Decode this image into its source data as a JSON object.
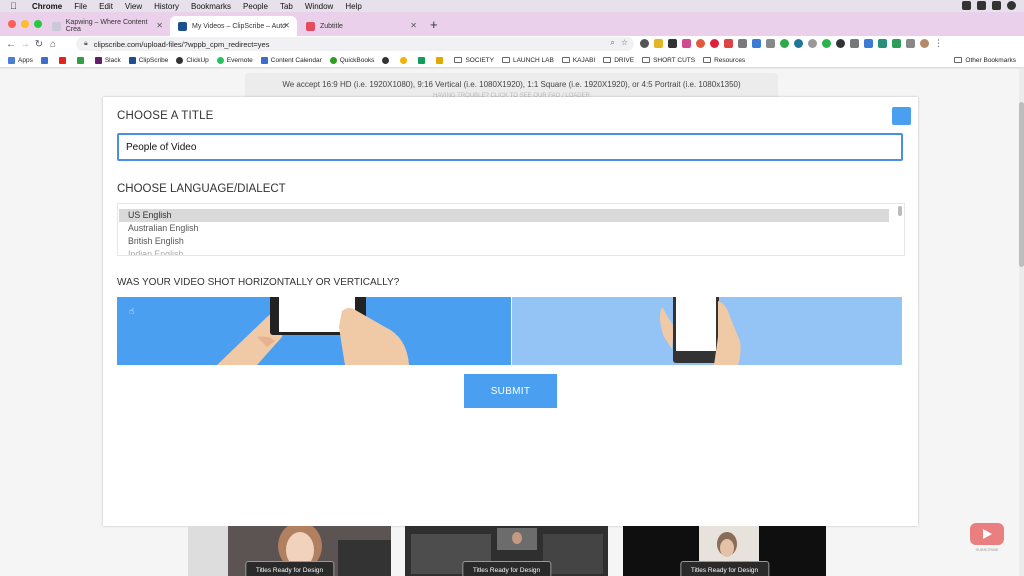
{
  "menubar": {
    "app": "Chrome",
    "items": [
      "File",
      "Edit",
      "View",
      "History",
      "Bookmarks",
      "People",
      "Tab",
      "Window",
      "Help"
    ]
  },
  "tabs": [
    {
      "label": "Kapwing – Where Content Crea",
      "active": false
    },
    {
      "label": "My Videos – ClipScribe – Auto",
      "active": true
    },
    {
      "label": "Zubtitle",
      "active": false
    }
  ],
  "toolbar": {
    "url": "clipscribe.com/upload-files/?wppb_cpm_redirect=yes"
  },
  "bookmarks": {
    "items": [
      "Apps",
      "Slack",
      "ClipScribe",
      "ClickUp",
      "Evernote",
      "Content Calendar",
      "QuickBooks",
      "SOCIETY",
      "LAUNCH LAB",
      "KAJABI",
      "DRIVE",
      "SHORT CUTS",
      "Resources"
    ],
    "other": "Other Bookmarks"
  },
  "page": {
    "info_text": "We accept 16:9 HD (i.e. 1920X1080), 9:16 Vertical (i.e. 1080X1920), 1:1 Square (i.e. 1920X1920), or 4:5 Portrait (i.e. 1080x1350)",
    "info_subtext": "HAVING TROUBLE? CLICK TO SEE OUR FAQ / LOADER",
    "title_heading": "CHOOSE A TITLE",
    "title_value": "People of Video",
    "language_heading": "CHOOSE LANGUAGE/DIALECT",
    "languages": [
      "US English",
      "Australian English",
      "British English",
      "Indian English"
    ],
    "selected_language": "US English",
    "orientation_heading": "WAS YOUR VIDEO SHOT HORIZONTALLY OR VERTICALLY?",
    "submit_label": "SUBMIT",
    "video_cards": [
      {
        "label": "Titles Ready for Design"
      },
      {
        "label": "Titles Ready for Design"
      },
      {
        "label": "Titles Ready for Design"
      }
    ],
    "youtube_label": "SUBSCRIBE"
  },
  "colors": {
    "accent_blue": "#4a9ff0",
    "light_blue": "#94c4f5",
    "tabstrip": "#ead0ea"
  }
}
